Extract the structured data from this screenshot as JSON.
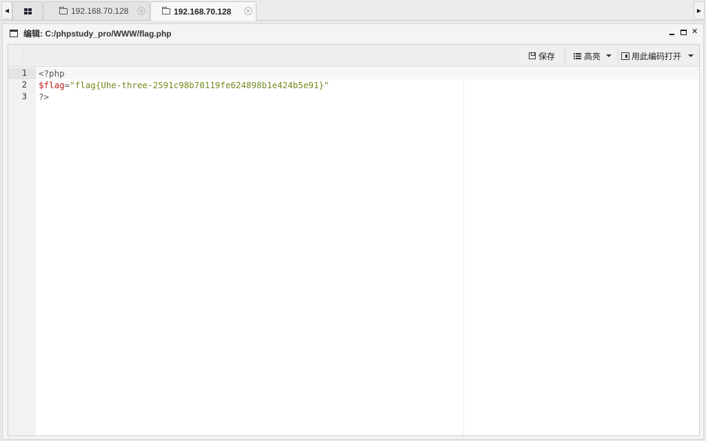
{
  "tabs": {
    "items": [
      {
        "label": "192.168.70.128",
        "active": false
      },
      {
        "label": "192.168.70.128",
        "active": true
      }
    ]
  },
  "window": {
    "title": "编辑: C:/phpstudy_pro/WWW/flag.php"
  },
  "toolbar": {
    "save_label": "保存",
    "highlight_label": "高亮",
    "encoding_label": "用此编码打开"
  },
  "editor": {
    "lines": [
      {
        "number": "1",
        "tokens": [
          {
            "cls": "tok-tag",
            "text": "<?php"
          }
        ]
      },
      {
        "number": "2",
        "tokens": [
          {
            "cls": "tok-var",
            "text": "$flag"
          },
          {
            "cls": "tok-op",
            "text": "="
          },
          {
            "cls": "tok-str",
            "text": "\"flag{Uhe-three-2591c98b70119fe624898b1e424b5e91}\""
          }
        ]
      },
      {
        "number": "3",
        "tokens": [
          {
            "cls": "tok-tag",
            "text": "?>"
          }
        ]
      }
    ],
    "active_line": 1
  }
}
